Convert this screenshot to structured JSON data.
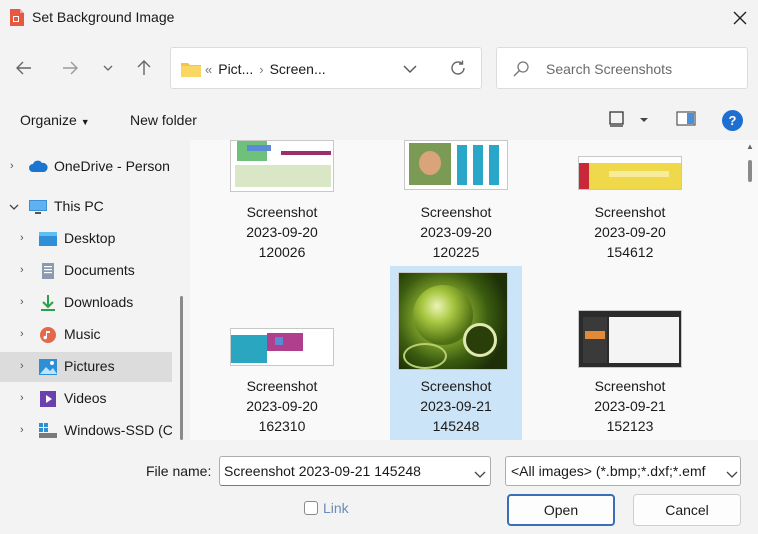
{
  "window": {
    "title": "Set Background Image"
  },
  "nav": {
    "breadcrumbs": [
      "Pict...",
      "Screen..."
    ],
    "breadcrumb_overflow": "«",
    "search_placeholder": "Search Screenshots"
  },
  "commands": {
    "organize": "Organize",
    "new_folder": "New folder",
    "help": "?"
  },
  "tree": [
    {
      "label": "OneDrive - Person",
      "icon": "cloud-icon",
      "indent": 0,
      "selected": false
    },
    {
      "label": "This PC",
      "icon": "computer-icon",
      "indent": 0,
      "selected": false,
      "expanded": true
    },
    {
      "label": "Desktop",
      "icon": "desktop-folder-icon",
      "indent": 1,
      "selected": false
    },
    {
      "label": "Documents",
      "icon": "documents-folder-icon",
      "indent": 1,
      "selected": false
    },
    {
      "label": "Downloads",
      "icon": "download-icon",
      "indent": 1,
      "selected": false
    },
    {
      "label": "Music",
      "icon": "music-icon",
      "indent": 1,
      "selected": false
    },
    {
      "label": "Pictures",
      "icon": "pictures-folder-icon",
      "indent": 1,
      "selected": true
    },
    {
      "label": "Videos",
      "icon": "videos-folder-icon",
      "indent": 1,
      "selected": false
    },
    {
      "label": "Windows-SSD (C",
      "icon": "drive-icon",
      "indent": 1,
      "selected": false
    }
  ],
  "files": [
    {
      "line1": "Screenshot",
      "line2": "2023-09-20",
      "line3": "120026",
      "selected": false
    },
    {
      "line1": "Screenshot",
      "line2": "2023-09-20",
      "line3": "120225",
      "selected": false
    },
    {
      "line1": "Screenshot",
      "line2": "2023-09-20",
      "line3": "154612",
      "selected": false
    },
    {
      "line1": "Screenshot",
      "line2": "2023-09-20",
      "line3": "162310",
      "selected": false
    },
    {
      "line1": "Screenshot",
      "line2": "2023-09-21",
      "line3": "145248",
      "selected": true
    },
    {
      "line1": "Screenshot",
      "line2": "2023-09-21",
      "line3": "152123",
      "selected": false
    }
  ],
  "footer": {
    "file_name_label": "File name:",
    "file_name_value": "Screenshot 2023-09-21 145248",
    "file_type_value": "<All images> (*.bmp;*.dxf;*.emf",
    "link_label": "Link",
    "open_label": "Open",
    "cancel_label": "Cancel"
  }
}
